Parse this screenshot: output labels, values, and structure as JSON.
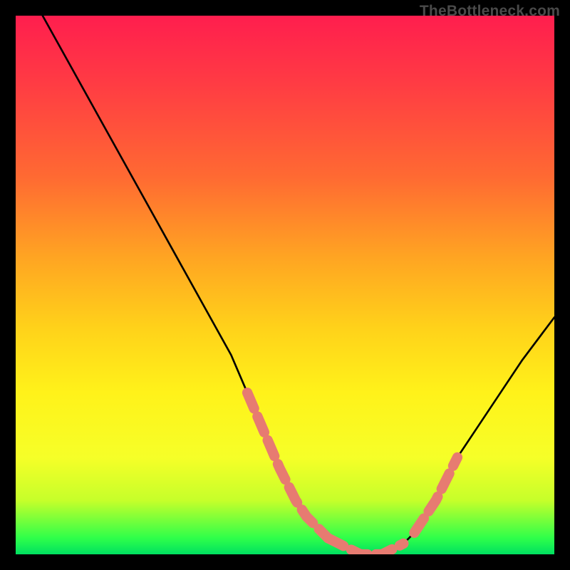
{
  "watermark": "TheBottleneck.com",
  "colors": {
    "background": "#000000",
    "curve": "#000000",
    "highlight": "#e77b71",
    "watermark": "#4a4a4a"
  },
  "chart_data": {
    "type": "line",
    "title": "",
    "xlabel": "",
    "ylabel": "",
    "xlim": [
      0,
      100
    ],
    "ylim": [
      0,
      100
    ],
    "grid": false,
    "legend": false,
    "series": [
      {
        "name": "bottleneck-curve",
        "x": [
          5,
          10,
          15,
          20,
          25,
          30,
          35,
          40,
          43,
          46,
          49,
          52,
          54,
          56,
          58,
          60,
          62,
          64,
          66,
          68,
          70,
          72,
          74,
          76,
          78,
          80,
          82,
          86,
          90,
          94,
          100
        ],
        "values": [
          100,
          91,
          82,
          73,
          64,
          55,
          46,
          37,
          30,
          23,
          16,
          10,
          7,
          5,
          3,
          2,
          1,
          0,
          0,
          0,
          1,
          2,
          4,
          7,
          10,
          14,
          18,
          24,
          30,
          36,
          44
        ]
      }
    ],
    "highlighted_segments": [
      {
        "description": "left-descent-near-bottom",
        "x": [
          43,
          46,
          49,
          52,
          54,
          56,
          58
        ],
        "values": [
          30,
          23,
          16,
          10,
          7,
          5,
          3
        ]
      },
      {
        "description": "trough",
        "x": [
          58,
          60,
          62,
          64,
          66,
          68,
          70,
          72
        ],
        "values": [
          3,
          2,
          1,
          0,
          0,
          0,
          1,
          2
        ]
      },
      {
        "description": "right-ascent-near-bottom",
        "x": [
          74,
          76,
          78,
          80,
          82
        ],
        "values": [
          4,
          7,
          10,
          14,
          18
        ]
      }
    ]
  }
}
